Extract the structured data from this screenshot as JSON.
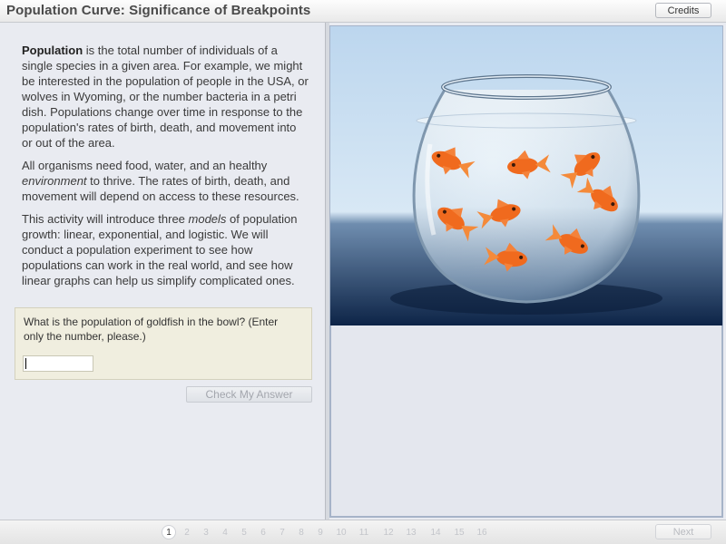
{
  "app": {
    "title": "Population Curve: Significance of Breakpoints",
    "credits_label": "Credits"
  },
  "content": {
    "p1_term": "Population",
    "p1_text": " is the total number of individuals of a single species in a given area. For example, we might be interested in the population of people in the USA, or wolves in Wyoming, or the number bacteria in a petri dish.  Populations change over time in response to the population's rates of birth, death, and movement into or out of the area.",
    "p2_a": "All organisms need food, water, and an healthy ",
    "p2_em": "environment",
    "p2_b": " to thrive. The rates of birth, death, and movement will depend on access to these resources.",
    "p3_a": "This activity will introduce three ",
    "p3_em": "models",
    "p3_b": " of population growth: linear, exponential, and logistic.  We will conduct a population experiment to see how populations can work in the real world, and see how linear graphs can help us simplify complicated ones."
  },
  "question": {
    "text": "What is the population of goldfish in the bowl? (Enter only the number, please.)",
    "answer_value": "",
    "check_label": "Check My Answer"
  },
  "pagination": {
    "pages": [
      "1",
      "2",
      "3",
      "4",
      "5",
      "6",
      "7",
      "8",
      "9",
      "10",
      "11",
      "12",
      "13",
      "14",
      "15",
      "16"
    ],
    "current": "1",
    "next_label": "Next"
  },
  "colors": {
    "water": "#cfe3f2",
    "goldfish": "#f06a1e",
    "disabled_text": "#a3a6ad"
  }
}
